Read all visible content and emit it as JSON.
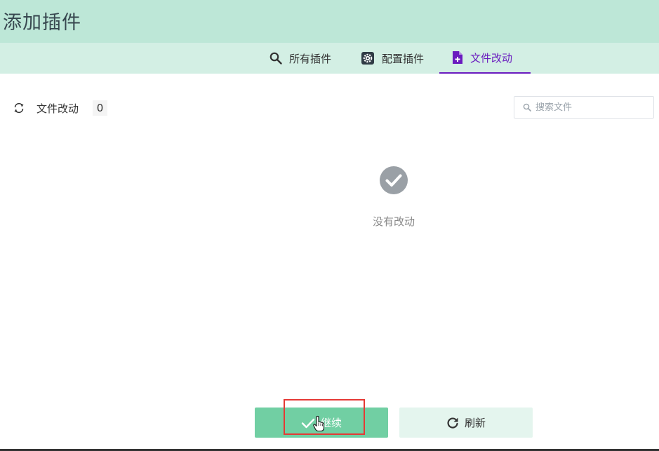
{
  "header": {
    "title": "添加插件"
  },
  "tabs": [
    {
      "label": "所有插件",
      "icon": "search-icon",
      "active": false
    },
    {
      "label": "配置插件",
      "icon": "gear-icon",
      "active": false
    },
    {
      "label": "文件改动",
      "icon": "file-plus-icon",
      "active": true
    }
  ],
  "file_bar": {
    "label": "文件改动",
    "count": "0",
    "search_placeholder": "搜索文件"
  },
  "empty_state": {
    "message": "没有改动",
    "icon": "check-circle-icon"
  },
  "actions": {
    "continue_label": "继续",
    "refresh_label": "刷新"
  },
  "colors": {
    "header_bg": "#bde7d7",
    "tabbar_bg": "#d3efe4",
    "accent": "#6a1bbf",
    "primary": "#71cfa3",
    "secondary": "#e4f5ee",
    "highlight": "#e53935"
  }
}
